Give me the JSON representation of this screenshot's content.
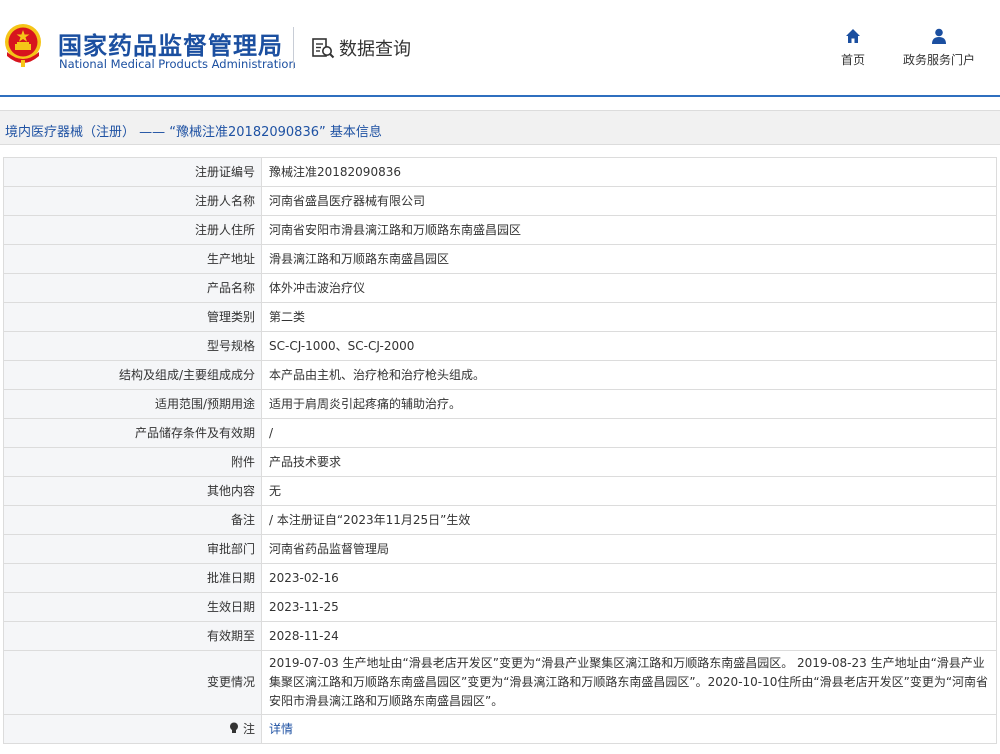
{
  "header": {
    "org_name_cn": "国家药品监督管理局",
    "org_name_en": "National Medical Products Administration",
    "data_query_label": "数据查询",
    "nav": [
      {
        "label": "首页",
        "icon": "home-icon"
      },
      {
        "label": "政务服务门户",
        "icon": "user-icon"
      }
    ]
  },
  "colors": {
    "brand": "#1b4fa0",
    "accent_line": "#2f6fbf",
    "link": "#1f52a3",
    "emblem_red": "#d7141e",
    "emblem_gold": "#f5c518"
  },
  "breadcrumb": "境内医疗器械（注册） —— “豫械注准20182090836” 基本信息",
  "rows": [
    {
      "label": "注册证编号",
      "value": "豫械注准20182090836"
    },
    {
      "label": "注册人名称",
      "value": "河南省盛昌医疗器械有限公司"
    },
    {
      "label": "注册人住所",
      "value": "河南省安阳市滑县漓江路和万顺路东南盛昌园区"
    },
    {
      "label": "生产地址",
      "value": "滑县漓江路和万顺路东南盛昌园区"
    },
    {
      "label": "产品名称",
      "value": "体外冲击波治疗仪"
    },
    {
      "label": "管理类别",
      "value": "第二类"
    },
    {
      "label": "型号规格",
      "value": "SC-CJ-1000、SC-CJ-2000"
    },
    {
      "label": "结构及组成/主要组成成分",
      "value": "本产品由主机、治疗枪和治疗枪头组成。"
    },
    {
      "label": "适用范围/预期用途",
      "value": "适用于肩周炎引起疼痛的辅助治疗。"
    },
    {
      "label": "产品储存条件及有效期",
      "value": "/"
    },
    {
      "label": "附件",
      "value": "产品技术要求"
    },
    {
      "label": "其他内容",
      "value": "无"
    },
    {
      "label": "备注",
      "value": "/ 本注册证自“2023年11月25日”生效"
    },
    {
      "label": "审批部门",
      "value": "河南省药品监督管理局"
    },
    {
      "label": "批准日期",
      "value": "2023-02-16"
    },
    {
      "label": "生效日期",
      "value": "2023-11-25"
    },
    {
      "label": "有效期至",
      "value": "2028-11-24"
    },
    {
      "label": "变更情况",
      "value": "2019-07-03 生产地址由“滑县老店开发区”变更为“滑县产业聚集区漓江路和万顺路东南盛昌园区。 2019-08-23 生产地址由“滑县产业集聚区漓江路和万顺路东南盛昌园区”变更为“滑县漓江路和万顺路东南盛昌园区”。2020-10-10住所由“滑县老店开发区”变更为“河南省安阳市滑县漓江路和万顺路东南盛昌园区”。"
    }
  ],
  "note_row": {
    "label": "注",
    "icon": "bulb-icon",
    "link_text": "详情"
  }
}
